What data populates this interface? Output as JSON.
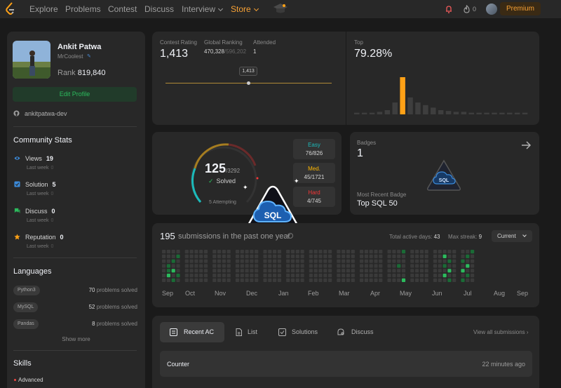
{
  "nav": {
    "items": [
      "Explore",
      "Problems",
      "Contest",
      "Discuss"
    ],
    "interview": "Interview",
    "store": "Store",
    "flame_count": "0",
    "premium": "Premium"
  },
  "profile": {
    "name": "Ankit Patwa",
    "username": "MrCoolest",
    "rank_label": "Rank",
    "rank_value": "819,840",
    "edit_button": "Edit Profile",
    "github": "ankitpatwa-dev"
  },
  "community": {
    "title": "Community Stats",
    "stats": [
      {
        "label": "Views",
        "value": "19",
        "sub": "Last week",
        "sub_value": "0"
      },
      {
        "label": "Solution",
        "value": "5",
        "sub": "Last week",
        "sub_value": "0"
      },
      {
        "label": "Discuss",
        "value": "0",
        "sub": "Last week",
        "sub_value": "0"
      },
      {
        "label": "Reputation",
        "value": "0",
        "sub": "Last week",
        "sub_value": "0"
      }
    ]
  },
  "languages": {
    "title": "Languages",
    "items": [
      {
        "name": "Python3",
        "count": "70",
        "suffix": "problems solved"
      },
      {
        "name": "MySQL",
        "count": "52",
        "suffix": "problems solved"
      },
      {
        "name": "Pandas",
        "count": "8",
        "suffix": "problems solved"
      }
    ],
    "show_more": "Show more"
  },
  "skills": {
    "title": "Skills",
    "first": "Advanced"
  },
  "rating": {
    "contest_label": "Contest Rating",
    "contest_value": "1,413",
    "global_label": "Global Ranking",
    "global_value": "470,328",
    "global_total": "/596,202",
    "attended_label": "Attended",
    "attended_value": "1",
    "tooltip": "1,413",
    "top_label": "Top",
    "top_value": "79.28%",
    "histogram": [
      2,
      2,
      2,
      3,
      5,
      14,
      44,
      20,
      14,
      11,
      8,
      5,
      4,
      3,
      3,
      2,
      2,
      2,
      2,
      2,
      2,
      2,
      2
    ]
  },
  "solved": {
    "count": "125",
    "total": "/3292",
    "label": "Solved",
    "attempting": "5 Attempting",
    "easy": {
      "name": "Easy",
      "value": "76/826",
      "color": "#1cbaba"
    },
    "medium": {
      "name": "Med.",
      "value": "45/1721",
      "color": "#ffb700"
    },
    "hard": {
      "name": "Hard",
      "value": "4/745",
      "color": "#f63737"
    }
  },
  "badges": {
    "title": "Badges",
    "count": "1",
    "recent_label": "Most Recent Badge",
    "recent_value": "Top SQL 50",
    "badge_text": "SQL"
  },
  "submissions": {
    "count": "195",
    "text": "submissions in the past one year",
    "active_label": "Total active days:",
    "active_value": "43",
    "streak_label": "Max streak:",
    "streak_value": "9",
    "select": "Current",
    "months": [
      "Sep",
      "Oct",
      "Nov",
      "Dec",
      "Jan",
      "Feb",
      "Mar",
      "Apr",
      "May",
      "Jun",
      "Jul",
      "Aug",
      "Sep"
    ]
  },
  "recent": {
    "tabs": [
      "Recent AC",
      "List",
      "Solutions",
      "Discuss"
    ],
    "view_all": "View all submissions",
    "rows": [
      {
        "title": "Counter",
        "time": "22 minutes ago"
      }
    ]
  }
}
